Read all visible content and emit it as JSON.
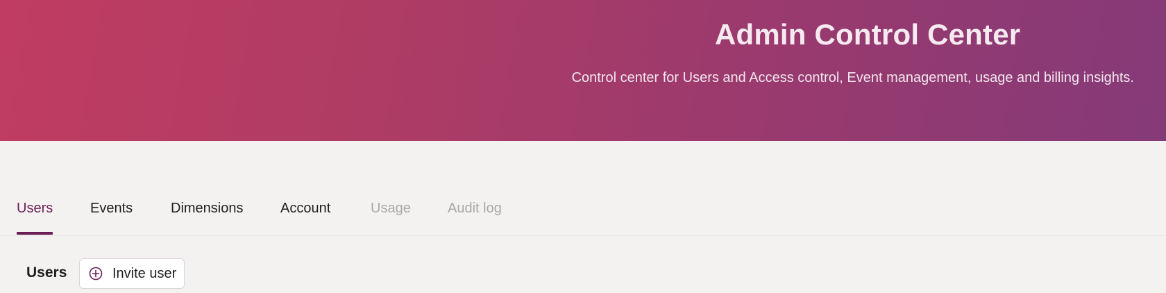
{
  "header": {
    "title": "Admin Control Center",
    "subtitle": "Control center for Users and Access control, Event management, usage and billing insights."
  },
  "tabs": [
    {
      "label": "Users",
      "state": "active"
    },
    {
      "label": "Events",
      "state": "enabled"
    },
    {
      "label": "Dimensions",
      "state": "enabled"
    },
    {
      "label": "Account",
      "state": "enabled"
    },
    {
      "label": "Usage",
      "state": "disabled"
    },
    {
      "label": "Audit log",
      "state": "disabled"
    }
  ],
  "users_section": {
    "title": "Users",
    "invite_button": {
      "label": "Invite user",
      "icon": "plus-circle-icon"
    }
  },
  "colors": {
    "accent": "#6b1e56",
    "header_gradient_start": "#c03c62",
    "header_gradient_end": "#853a78",
    "disabled_text": "#a9a8a8"
  }
}
